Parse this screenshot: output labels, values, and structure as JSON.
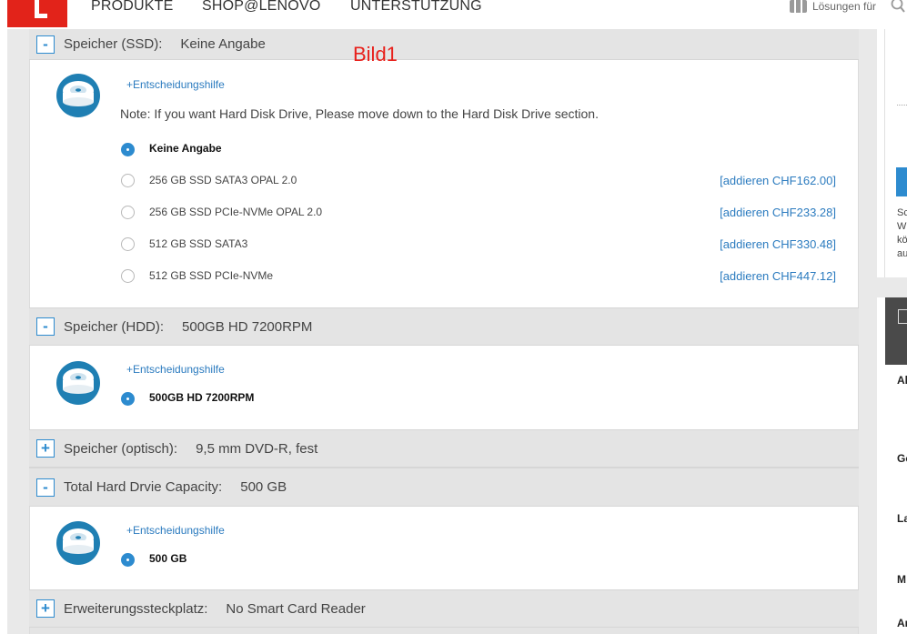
{
  "nav": {
    "items": [
      "PRODUKTE",
      "SHOP@LENOVO",
      "UNTERSTÜTZUNG"
    ],
    "solutions_label": "Lösungen für"
  },
  "annotation": "Bild1",
  "colors": {
    "accent": "#2d8bcf",
    "brand_red": "#e2231a",
    "link": "#2b7bbf",
    "annotation": "#e8201b"
  },
  "sections": {
    "ssd": {
      "toggle": "-",
      "title": "Speicher (SSD):",
      "value": "Keine Angabe",
      "help": "+Entscheidungshilfe",
      "note": "Note: If you want Hard Disk Drive, Please move down to the Hard Disk Drive section.",
      "options": [
        {
          "label": "Keine Angabe",
          "price": "",
          "selected": true
        },
        {
          "label": "256 GB SSD SATA3 OPAL 2.0",
          "price": "[addieren CHF162.00]",
          "selected": false
        },
        {
          "label": "256 GB SSD PCIe-NVMe OPAL 2.0",
          "price": "[addieren CHF233.28]",
          "selected": false
        },
        {
          "label": "512 GB SSD SATA3",
          "price": "[addieren CHF330.48]",
          "selected": false
        },
        {
          "label": "512 GB SSD PCIe-NVMe",
          "price": "[addieren CHF447.12]",
          "selected": false
        }
      ]
    },
    "hdd": {
      "toggle": "-",
      "title": "Speicher (HDD):",
      "value": "500GB HD 7200RPM",
      "help": "+Entscheidungshilfe",
      "options": [
        {
          "label": "500GB HD 7200RPM",
          "selected": true
        }
      ]
    },
    "optical": {
      "toggle": "+",
      "title": "Speicher (optisch):",
      "value": "9,5 mm DVD-R, fest"
    },
    "total": {
      "toggle": "-",
      "title": "Total Hard Drvie Capacity:",
      "value": "500 GB",
      "help": "+Entscheidungshilfe",
      "options": [
        {
          "label": "500 GB",
          "selected": true
        }
      ]
    },
    "expansion": {
      "toggle": "+",
      "title": "Erweiterungssteckplatz:",
      "value": "No Smart Card Reader"
    }
  },
  "sidebar": {
    "text_lines": [
      "Sc",
      "W",
      "kö",
      "au"
    ],
    "labels": [
      "Al",
      "Ge",
      "La",
      "M",
      "Ar"
    ]
  }
}
